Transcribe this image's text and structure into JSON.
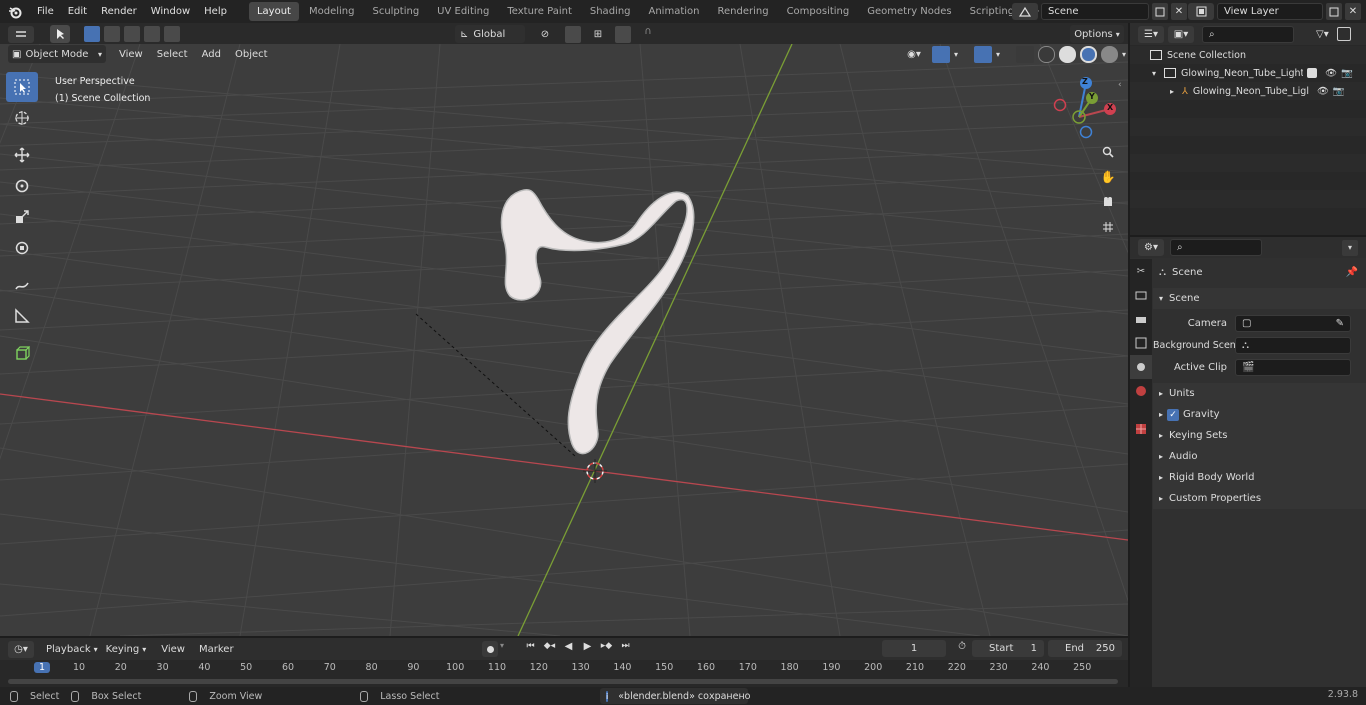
{
  "topbar": {
    "menus": [
      "File",
      "Edit",
      "Render",
      "Window",
      "Help"
    ],
    "workspaces": [
      "Layout",
      "Modeling",
      "Sculpting",
      "UV Editing",
      "Texture Paint",
      "Shading",
      "Animation",
      "Rendering",
      "Compositing",
      "Geometry Nodes",
      "Scripting"
    ],
    "active_workspace": "Layout",
    "scene_name": "Scene",
    "view_layer": "View Layer"
  },
  "viewport_header": {
    "mode": "Object Mode",
    "menus": [
      "View",
      "Select",
      "Add",
      "Object"
    ],
    "transform_orientation": "Global",
    "options_label": "Options"
  },
  "viewport": {
    "perspective_label": "User Perspective",
    "collection_label": "(1) Scene Collection",
    "gizmo_axes": [
      "X",
      "Y",
      "Z"
    ]
  },
  "outliner": {
    "root": "Scene Collection",
    "items": [
      {
        "label": "Glowing_Neon_Tube_Light_Di"
      },
      {
        "label": "Glowing_Neon_Tube_Ligl"
      }
    ]
  },
  "properties": {
    "context_title": "Scene",
    "section_title": "Scene",
    "fields": [
      {
        "label": "Camera",
        "value": ""
      },
      {
        "label": "Background Scene",
        "value": ""
      },
      {
        "label": "Active Clip",
        "value": ""
      }
    ],
    "panels": [
      "Units",
      "Gravity",
      "Keying Sets",
      "Audio",
      "Rigid Body World",
      "Custom Properties"
    ],
    "gravity_enabled": true
  },
  "timeline": {
    "menus": [
      "Playback",
      "Keying",
      "View",
      "Marker"
    ],
    "current_frame": "1",
    "start_label": "Start",
    "start_value": "1",
    "end_label": "End",
    "end_value": "250",
    "ruler_marks": [
      "1",
      "10",
      "20",
      "30",
      "40",
      "50",
      "60",
      "70",
      "80",
      "90",
      "100",
      "110",
      "120",
      "130",
      "140",
      "150",
      "160",
      "170",
      "180",
      "190",
      "200",
      "210",
      "220",
      "230",
      "240",
      "250"
    ]
  },
  "statusbar": {
    "select": "Select",
    "box_select": "Box Select",
    "zoom_view": "Zoom View",
    "lasso_select": "Lasso Select",
    "message": "«blender.blend» сохранено",
    "version": "2.93.8"
  },
  "colors": {
    "accent": "#4772b3",
    "x_axis": "#b8474f",
    "y_axis": "#7a9e35",
    "z_axis": "#3f82d6"
  }
}
